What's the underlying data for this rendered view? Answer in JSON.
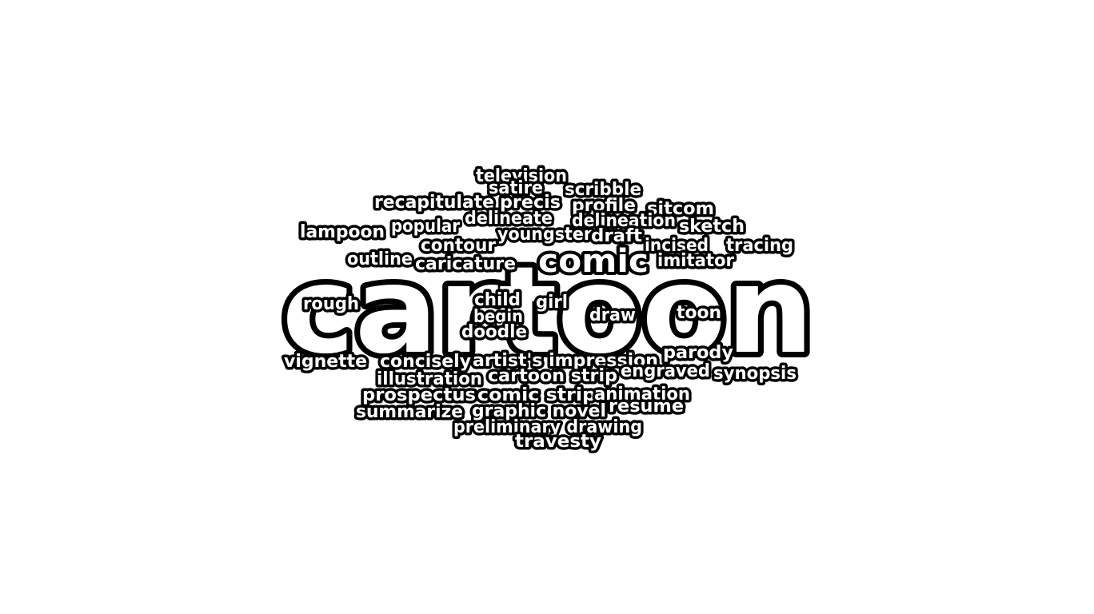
{
  "word_cloud": {
    "ink_color": "#000000",
    "fill_color": "#ffffff",
    "background_color": "#ffffff",
    "words": [
      "cartoon",
      "comic",
      "television",
      "satire",
      "scribble",
      "recapitulate",
      "precis",
      "profile",
      "sitcom",
      "delineate",
      "delineation",
      "sketch",
      "lampoon",
      "popular",
      "youngster",
      "draft",
      "contour",
      "incised",
      "tracing",
      "outline",
      "caricature",
      "imitator",
      "rough",
      "child",
      "girl",
      "begin",
      "draw",
      "toon",
      "doodle",
      "parody",
      "vignette",
      "concisely",
      "artist's impression",
      "illustration",
      "cartoon strip",
      "engraved",
      "synopsis",
      "prospectus",
      "comic strip",
      "animation",
      "summarize",
      "graphic novel",
      "resume",
      "preliminary drawing",
      "travesty"
    ]
  }
}
